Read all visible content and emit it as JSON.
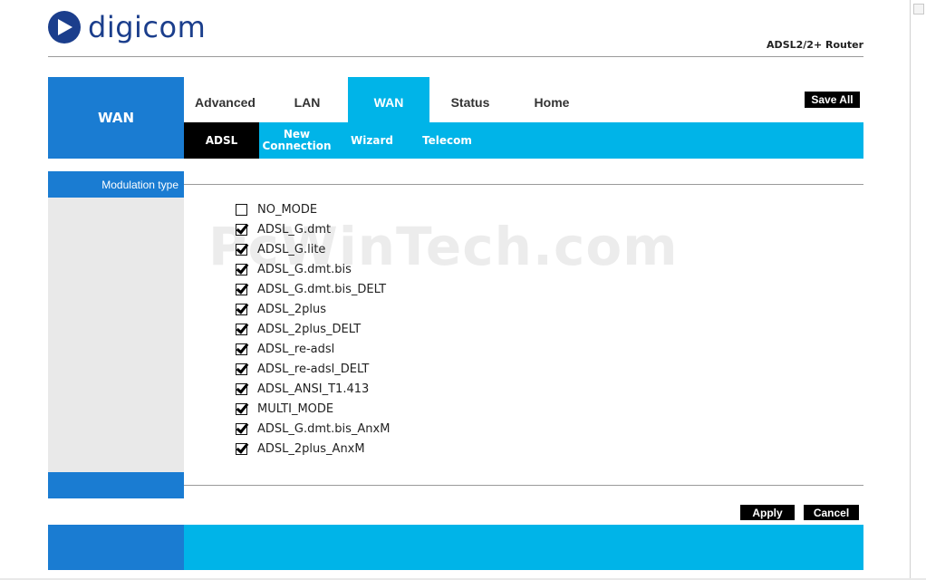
{
  "brand": {
    "name": "digicom",
    "product": "ADSL2/2+ Router"
  },
  "section_title": "WAN",
  "main_tabs": [
    {
      "label": "Advanced",
      "active": false
    },
    {
      "label": "LAN",
      "active": false
    },
    {
      "label": "WAN",
      "active": true
    },
    {
      "label": "Status",
      "active": false
    },
    {
      "label": "Home",
      "active": false
    }
  ],
  "save_all_label": "Save All",
  "sub_tabs": [
    {
      "label": "ADSL",
      "active": true
    },
    {
      "label": "New Connection",
      "active": false
    },
    {
      "label": "Wizard",
      "active": false
    },
    {
      "label": "Telecom",
      "active": false
    }
  ],
  "sidebar": {
    "heading": "Modulation type"
  },
  "watermark": "PcWinTech.com",
  "modulation_modes": [
    {
      "label": "NO_MODE",
      "checked": false
    },
    {
      "label": "ADSL_G.dmt",
      "checked": true
    },
    {
      "label": "ADSL_G.lite",
      "checked": true
    },
    {
      "label": "ADSL_G.dmt.bis",
      "checked": true
    },
    {
      "label": "ADSL_G.dmt.bis_DELT",
      "checked": true
    },
    {
      "label": "ADSL_2plus",
      "checked": true
    },
    {
      "label": "ADSL_2plus_DELT",
      "checked": true
    },
    {
      "label": "ADSL_re-adsl",
      "checked": true
    },
    {
      "label": "ADSL_re-adsl_DELT",
      "checked": true
    },
    {
      "label": "ADSL_ANSI_T1.413",
      "checked": true
    },
    {
      "label": "MULTI_MODE",
      "checked": true
    },
    {
      "label": "ADSL_G.dmt.bis_AnxM",
      "checked": true
    },
    {
      "label": "ADSL_2plus_AnxM",
      "checked": true
    }
  ],
  "buttons": {
    "apply": "Apply",
    "cancel": "Cancel"
  },
  "colors": {
    "primary_blue": "#1a7cd2",
    "cyan": "#00b4e8",
    "logo_blue": "#1b3e8c",
    "sidebar_gray": "#e9e9e9"
  }
}
